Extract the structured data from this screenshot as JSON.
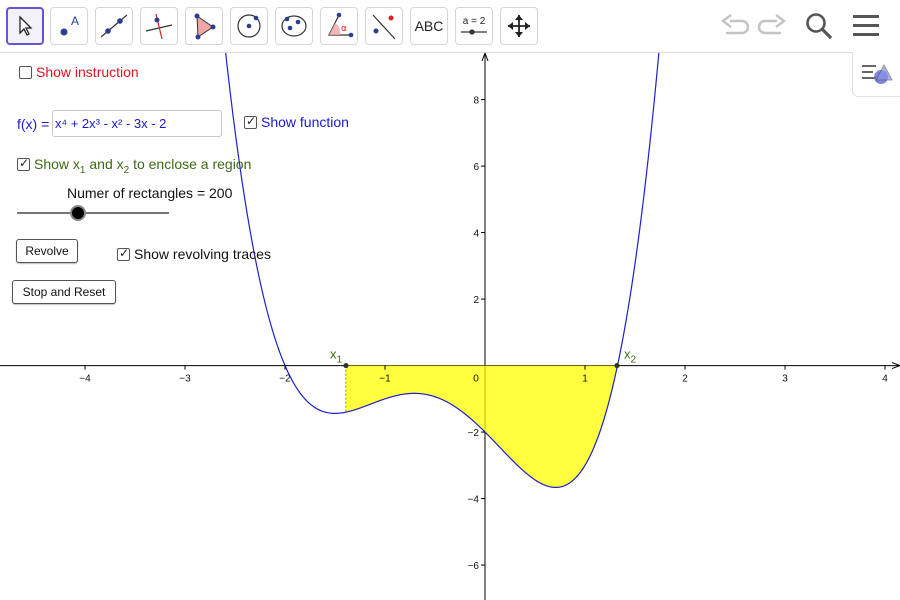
{
  "toolbar": {
    "tools": [
      {
        "name": "move-tool",
        "icon": "pointer-icon"
      },
      {
        "name": "point-tool",
        "icon": "point-icon",
        "glyph": "A"
      },
      {
        "name": "line-tool",
        "icon": "line-icon"
      },
      {
        "name": "perpendicular-tool",
        "icon": "perpendicular-icon"
      },
      {
        "name": "polygon-tool",
        "icon": "polygon-icon"
      },
      {
        "name": "circle-tool",
        "icon": "circle-icon"
      },
      {
        "name": "conic-tool",
        "icon": "conic-icon"
      },
      {
        "name": "angle-tool",
        "icon": "angle-icon",
        "glyph": "α"
      },
      {
        "name": "reflect-tool",
        "icon": "reflect-icon"
      },
      {
        "name": "text-tool",
        "icon": "text-icon",
        "label": "ABC"
      },
      {
        "name": "slider-tool",
        "icon": "slider-icon",
        "label": "a = 2"
      },
      {
        "name": "move-graphics-tool",
        "icon": "move-arrows-icon"
      }
    ],
    "right": [
      "undo-icon",
      "redo-icon",
      "search-icon",
      "menu-icon"
    ],
    "stylebar_icon": "stylebar-toggle-icon"
  },
  "controls": {
    "show_instruction": {
      "label": "Show instruction",
      "checked": false
    },
    "fx_label": "f(x) =",
    "fx_value": "x⁴ + 2x³ - x² - 3x - 2",
    "show_function": {
      "label": "Show function",
      "checked": true
    },
    "show_region": {
      "label_pre": "Show x",
      "sub1": "1",
      "label_mid": " and x",
      "sub2": "2",
      "label_post": " to enclose a region",
      "checked": true
    },
    "rectangles_label": "Numer of rectangles = 200",
    "rectangles_value": 200,
    "revolve_button": "Revolve",
    "show_traces": {
      "label": "Show revolving traces",
      "checked": true
    },
    "stop_reset_button": "Stop and Reset",
    "check_mark": "✓"
  },
  "chart_data": {
    "type": "line",
    "function": "x^4 + 2x^3 - x^2 - 3x - 2",
    "coefficients": [
      1,
      2,
      -1,
      -3,
      -2
    ],
    "xlim": [
      -4.85,
      4.15
    ],
    "ylim": [
      -7.05,
      9.4
    ],
    "x_ticks": [
      -4,
      -3,
      -2,
      -1,
      0,
      1,
      2,
      3,
      4
    ],
    "y_ticks": [
      -6,
      -4,
      -2,
      2,
      4,
      6,
      8
    ],
    "x_tick_labels": [
      "−4",
      "−3",
      "−2",
      "−1",
      "0",
      "1",
      "2",
      "3",
      "4"
    ],
    "y_tick_labels": [
      "−6",
      "−4",
      "−2",
      "2",
      "4",
      "6",
      "8"
    ],
    "x1": {
      "label": "x",
      "sub": "1",
      "x": -1.39
    },
    "x2": {
      "label": "x",
      "sub": "2",
      "x": 1.32
    },
    "region": {
      "from": -1.39,
      "to": 1.32,
      "fill": "#ffff00",
      "opacity": 0.75
    },
    "curve_color": "#2020c8",
    "point_color": "#3d6b13"
  }
}
